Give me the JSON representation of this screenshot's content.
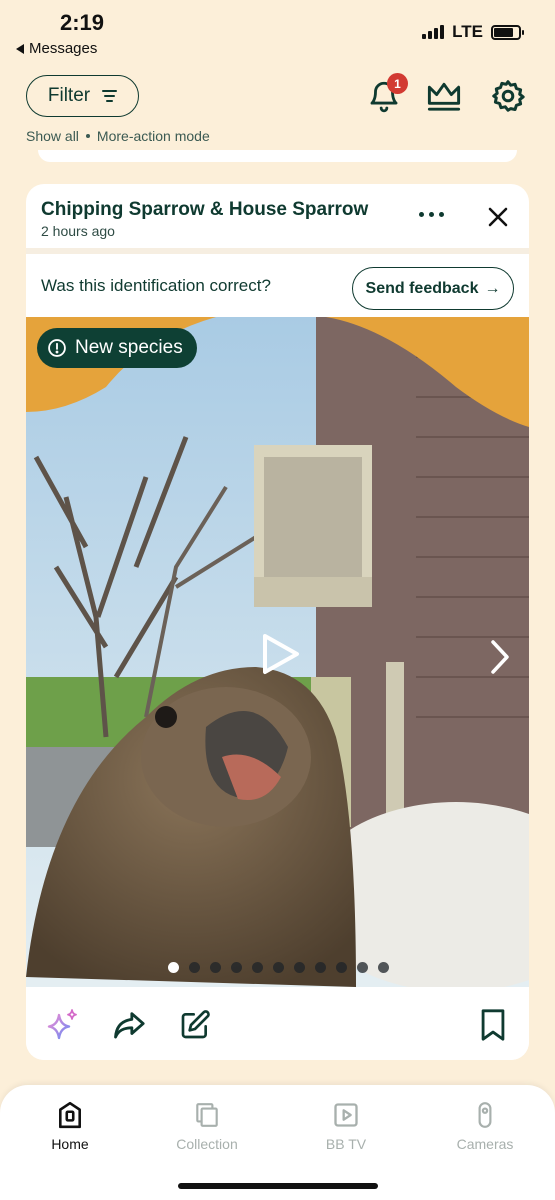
{
  "status_bar": {
    "time": "2:19",
    "back_label": "Messages",
    "network": "LTE"
  },
  "header": {
    "filter_label": "Filter",
    "notification_count": "1",
    "subnav": [
      "Show all",
      "More-action mode"
    ]
  },
  "card": {
    "title": "Chipping Sparrow & House Sparrow",
    "time_ago": "2 hours ago",
    "feedback_question": "Was this identification correct?",
    "feedback_button": "Send feedback",
    "badge_label": "New species",
    "media_count": 11,
    "active_index": 0
  },
  "icons": {
    "header": [
      "bell-icon",
      "crown-icon",
      "gear-icon"
    ],
    "card": [
      "more-icon",
      "close-icon",
      "play-icon",
      "chevron-right-icon"
    ],
    "actions": [
      "sparkle-icon",
      "share-icon",
      "edit-icon",
      "bookmark-icon"
    ]
  },
  "tabbar": {
    "tabs": [
      {
        "label": "Home",
        "icon": "home-icon",
        "active": true
      },
      {
        "label": "Collection",
        "icon": "collection-icon",
        "active": false
      },
      {
        "label": "BB TV",
        "icon": "tv-icon",
        "active": false
      },
      {
        "label": "Cameras",
        "icon": "camera-icon",
        "active": false
      }
    ]
  },
  "colors": {
    "background": "#fcefd9",
    "primary": "#0f3a30",
    "badge_red": "#d23a32",
    "pill": "#0e4034",
    "inactive_tab": "#a8b0ad"
  }
}
